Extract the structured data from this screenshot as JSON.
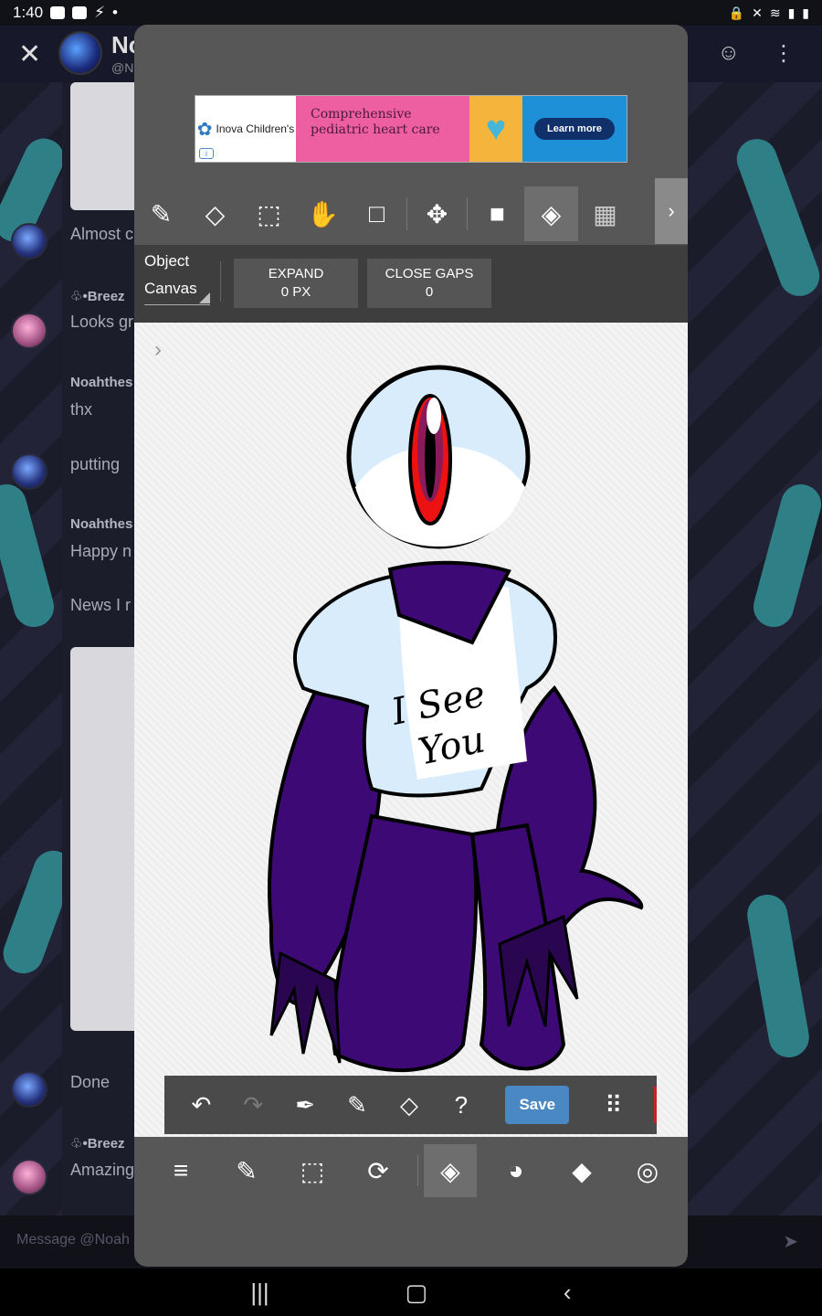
{
  "status_bar": {
    "time": "1:40"
  },
  "chat": {
    "title": "Nc",
    "handle": "@N",
    "messages": [
      {
        "text": "Almost c"
      },
      {
        "name": "♧•Breez",
        "text": "Looks gr"
      },
      {
        "name": "Noahthes",
        "text": "thx"
      },
      {
        "text": "putting"
      },
      {
        "name": "Noahthes",
        "text": "Happy n"
      },
      {
        "text": "News I r"
      },
      {
        "text": "Done"
      },
      {
        "name": "♧•Breez",
        "text": "Amazing"
      }
    ],
    "composer_placeholder": "Message @Noah"
  },
  "ad": {
    "brand": "Inova Children's",
    "headline": "Comprehensive pediatric heart care",
    "cta": "Learn more"
  },
  "toolbar": {
    "tools": [
      "pencil-icon",
      "eraser-icon",
      "selection-eraser-icon",
      "hand-icon",
      "rectangle-icon",
      "move-icon",
      "fill-color-icon",
      "bucket-icon",
      "gradient-icon"
    ],
    "active": "bucket-icon"
  },
  "options": {
    "mode_label": "Object",
    "mode_value": "Canvas",
    "expand_label": "EXPAND",
    "expand_value": "0 PX",
    "close_gaps_label": "CLOSE GAPS",
    "close_gaps_value": "0"
  },
  "drawing": {
    "text_line1": "I See",
    "text_line2": "You"
  },
  "bottom_bar": {
    "save_label": "Save",
    "current_color": "#c32424"
  },
  "menu_bar": {
    "items": [
      "menu-icon",
      "edit-icon",
      "select-icon",
      "transform-icon",
      "bucket-icon",
      "palette-icon",
      "layers-icon",
      "settings-icon"
    ],
    "active": "bucket-icon"
  }
}
